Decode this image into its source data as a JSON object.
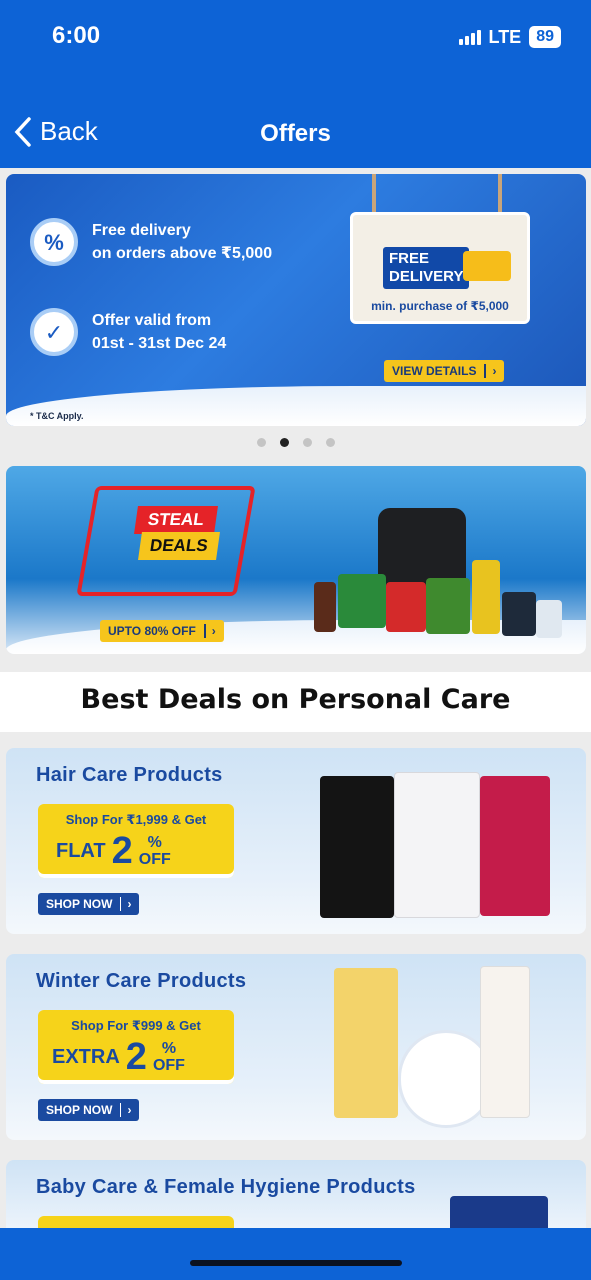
{
  "status_bar": {
    "time": "6:00",
    "network": "LTE",
    "battery": "89"
  },
  "nav": {
    "back_label": "Back",
    "title": "Offers"
  },
  "carousel": {
    "slide1": {
      "line1a": "Free delivery",
      "line1b": "on orders above ₹5,000",
      "line2a": "Offer valid from",
      "line2b": "01st - 31st Dec 24",
      "sign_title_1": "FREE",
      "sign_title_2": "DELIVERY",
      "sign_sub": "min. purchase of ₹5,000",
      "cta": "VIEW DETAILS",
      "tnc": "* T&C Apply."
    },
    "active_index": 1,
    "count": 4
  },
  "steal_banner": {
    "word1": "STEAL",
    "word2": "DEALS",
    "cta": "UPTO 80% OFF"
  },
  "section_title": "Best Deals on Personal Care",
  "promos": [
    {
      "title": "Hair Care Products",
      "line1": "Shop For ₹1,999 & Get",
      "word": "FLAT",
      "num": "2",
      "pct": "%",
      "off": "OFF",
      "cta": "SHOP NOW"
    },
    {
      "title": "Winter Care Products",
      "line1": "Shop For ₹999 & Get",
      "word": "EXTRA",
      "num": "2",
      "pct": "%",
      "off": "OFF",
      "cta": "SHOP NOW"
    },
    {
      "title": "Baby Care & Female Hygiene Products"
    }
  ],
  "colors": {
    "primary": "#0d63d6",
    "navy": "#1a4aa0",
    "yellow": "#f6d31a",
    "red": "#e52328"
  }
}
